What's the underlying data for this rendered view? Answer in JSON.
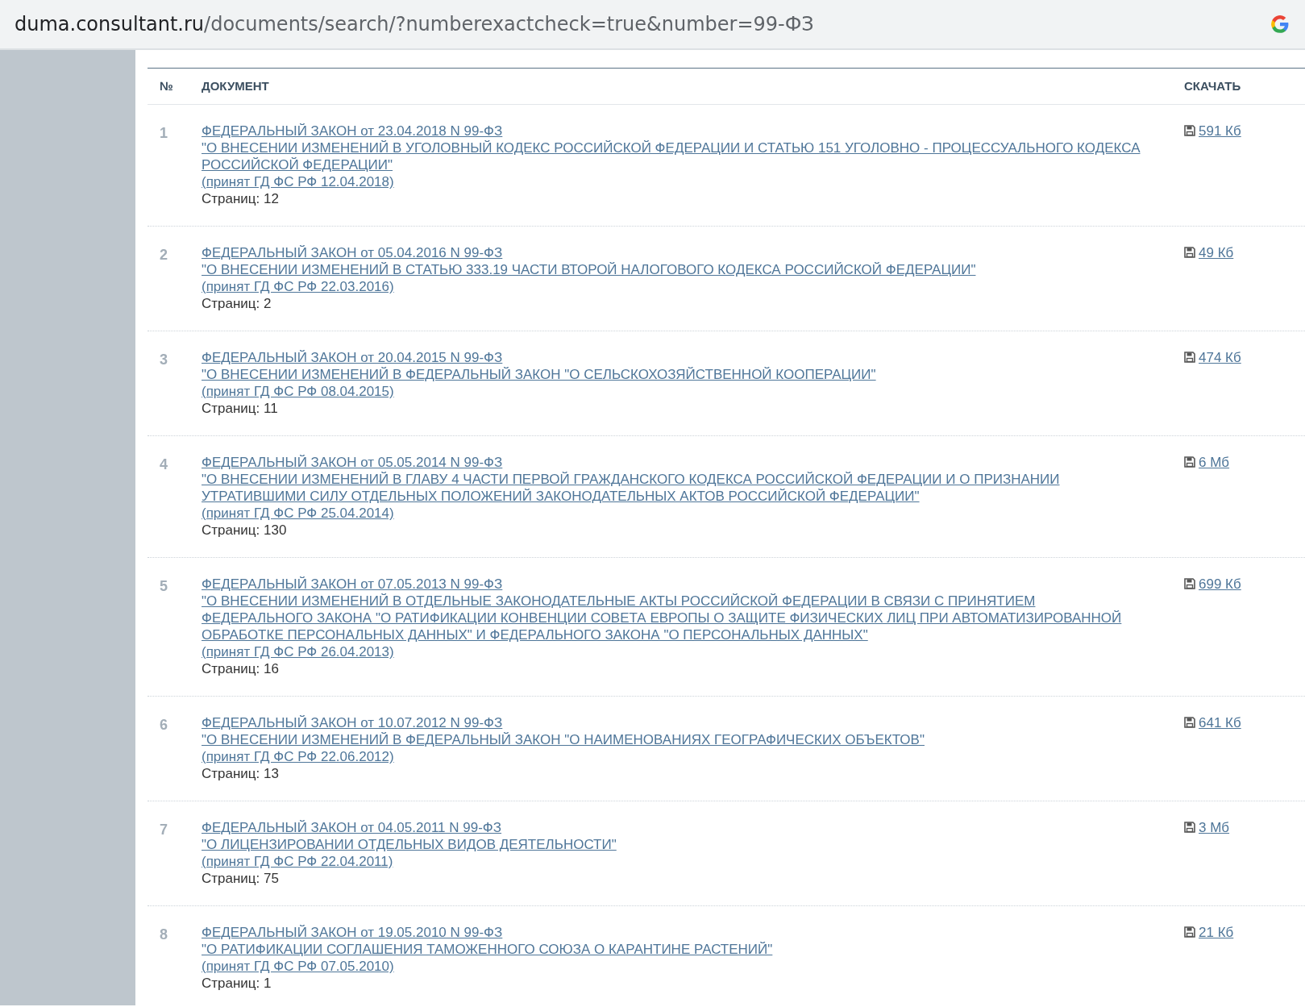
{
  "address_bar": {
    "domain": "duma.consultant.ru",
    "path": "/documents/search/?numberexactcheck=true&number=99-ФЗ"
  },
  "table": {
    "columns": [
      "№",
      "ДОКУМЕНТ",
      "СКАЧАТЬ"
    ],
    "rows": [
      {
        "number": "1",
        "title": "ФЕДЕРАЛЬНЫЙ ЗАКОН от 23.04.2018 N 99-ФЗ",
        "subject": "\"О ВНЕСЕНИИ ИЗМЕНЕНИЙ В УГОЛОВНЫЙ КОДЕКС РОССИЙСКОЙ ФЕДЕРАЦИИ И СТАТЬЮ 151 УГОЛОВНО - ПРОЦЕССУАЛЬНОГО КОДЕКСА РОССИЙСКОЙ ФЕДЕРАЦИИ\"",
        "adopted": "(принят ГД ФС РФ 12.04.2018)",
        "pages": "Страниц: 12",
        "size": "591 Кб"
      },
      {
        "number": "2",
        "title": "ФЕДЕРАЛЬНЫЙ ЗАКОН от 05.04.2016 N 99-ФЗ",
        "subject": "\"О ВНЕСЕНИИ ИЗМЕНЕНИЙ В СТАТЬЮ 333.19 ЧАСТИ ВТОРОЙ НАЛОГОВОГО КОДЕКСА РОССИЙСКОЙ ФЕДЕРАЦИИ\"",
        "adopted": "(принят ГД ФС РФ 22.03.2016)",
        "pages": "Страниц: 2",
        "size": "49 Кб"
      },
      {
        "number": "3",
        "title": "ФЕДЕРАЛЬНЫЙ ЗАКОН от 20.04.2015 N 99-ФЗ",
        "subject": "\"О ВНЕСЕНИИ ИЗМЕНЕНИЙ В ФЕДЕРАЛЬНЫЙ ЗАКОН \"О СЕЛЬСКОХОЗЯЙСТВЕННОЙ КООПЕРАЦИИ\"",
        "adopted": "(принят ГД ФС РФ 08.04.2015)",
        "pages": "Страниц: 11",
        "size": "474 Кб"
      },
      {
        "number": "4",
        "title": "ФЕДЕРАЛЬНЫЙ ЗАКОН от 05.05.2014 N 99-ФЗ",
        "subject": "\"О ВНЕСЕНИИ ИЗМЕНЕНИЙ В ГЛАВУ 4 ЧАСТИ ПЕРВОЙ ГРАЖДАНСКОГО КОДЕКСА РОССИЙСКОЙ ФЕДЕРАЦИИ И О ПРИЗНАНИИ УТРАТИВШИМИ СИЛУ ОТДЕЛЬНЫХ ПОЛОЖЕНИЙ ЗАКОНОДАТЕЛЬНЫХ АКТОВ РОССИЙСКОЙ ФЕДЕРАЦИИ\"",
        "adopted": "(принят ГД ФС РФ 25.04.2014)",
        "pages": "Страниц: 130",
        "size": "6 Мб"
      },
      {
        "number": "5",
        "title": "ФЕДЕРАЛЬНЫЙ ЗАКОН от 07.05.2013 N 99-ФЗ",
        "subject": "\"О ВНЕСЕНИИ ИЗМЕНЕНИЙ В ОТДЕЛЬНЫЕ ЗАКОНОДАТЕЛЬНЫЕ АКТЫ РОССИЙСКОЙ ФЕДЕРАЦИИ В СВЯЗИ С ПРИНЯТИЕМ ФЕДЕРАЛЬНОГО ЗАКОНА \"О РАТИФИКАЦИИ КОНВЕНЦИИ СОВЕТА ЕВРОПЫ О ЗАЩИТЕ ФИЗИЧЕСКИХ ЛИЦ ПРИ АВТОМАТИЗИРОВАННОЙ ОБРАБОТКЕ ПЕРСОНАЛЬНЫХ ДАННЫХ\" И ФЕДЕРАЛЬНОГО ЗАКОНА \"О ПЕРСОНАЛЬНЫХ ДАННЫХ\"",
        "adopted": "(принят ГД ФС РФ 26.04.2013)",
        "pages": "Страниц: 16",
        "size": "699 Кб"
      },
      {
        "number": "6",
        "title": "ФЕДЕРАЛЬНЫЙ ЗАКОН от 10.07.2012 N 99-ФЗ",
        "subject": "\"О ВНЕСЕНИИ ИЗМЕНЕНИЙ В ФЕДЕРАЛЬНЫЙ ЗАКОН \"О НАИМЕНОВАНИЯХ ГЕОГРАФИЧЕСКИХ ОБЪЕКТОВ\"",
        "adopted": "(принят ГД ФС РФ 22.06.2012)",
        "pages": "Страниц: 13",
        "size": "641 Кб"
      },
      {
        "number": "7",
        "title": "ФЕДЕРАЛЬНЫЙ ЗАКОН от 04.05.2011 N 99-ФЗ",
        "subject": "\"О ЛИЦЕНЗИРОВАНИИ ОТДЕЛЬНЫХ ВИДОВ ДЕЯТЕЛЬНОСТИ\"",
        "adopted": "(принят ГД ФС РФ 22.04.2011)",
        "pages": "Страниц: 75",
        "size": "3 Мб"
      },
      {
        "number": "8",
        "title": "ФЕДЕРАЛЬНЫЙ ЗАКОН от 19.05.2010 N 99-ФЗ",
        "subject": "\"О РАТИФИКАЦИИ СОГЛАШЕНИЯ ТАМОЖЕННОГО СОЮЗА О КАРАНТИНЕ РАСТЕНИЙ\"",
        "adopted": "(принят ГД ФС РФ 07.05.2010)",
        "pages": "Страниц: 1",
        "size": "21 Кб"
      }
    ]
  }
}
